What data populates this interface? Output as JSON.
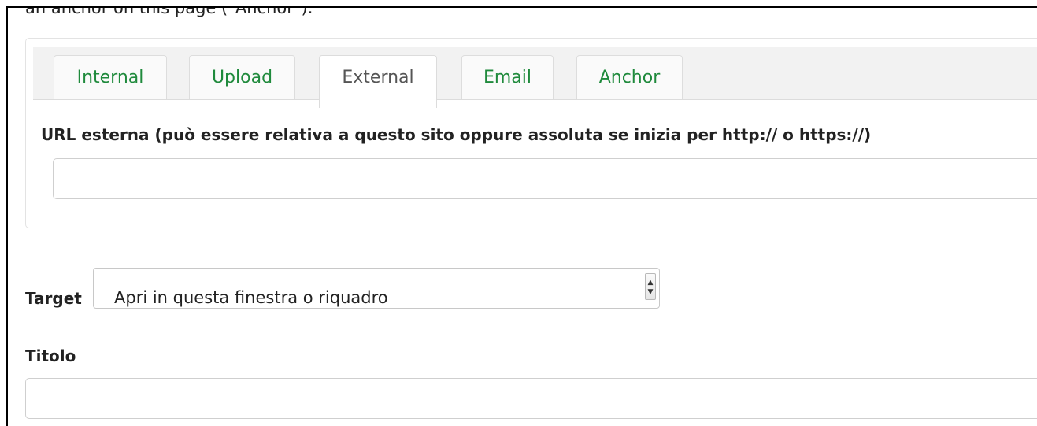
{
  "top_text": "an anchor on this page (\"Anchor\").",
  "tabs": [
    {
      "label": "Internal",
      "active": false
    },
    {
      "label": "Upload",
      "active": false
    },
    {
      "label": "External",
      "active": true
    },
    {
      "label": "Email",
      "active": false
    },
    {
      "label": "Anchor",
      "active": false
    }
  ],
  "external": {
    "url_label": "URL esterna (può essere relativa a questo sito oppure assoluta se inizia per http:// o https://)",
    "url_value": "",
    "url_placeholder": ""
  },
  "target": {
    "label": "Target",
    "selected": "Apri in questa finestra o riquadro"
  },
  "titolo": {
    "label": "Titolo",
    "value": "",
    "placeholder": ""
  },
  "colors": {
    "tab_link": "#1f8a3c",
    "tab_active_text": "#555555"
  }
}
